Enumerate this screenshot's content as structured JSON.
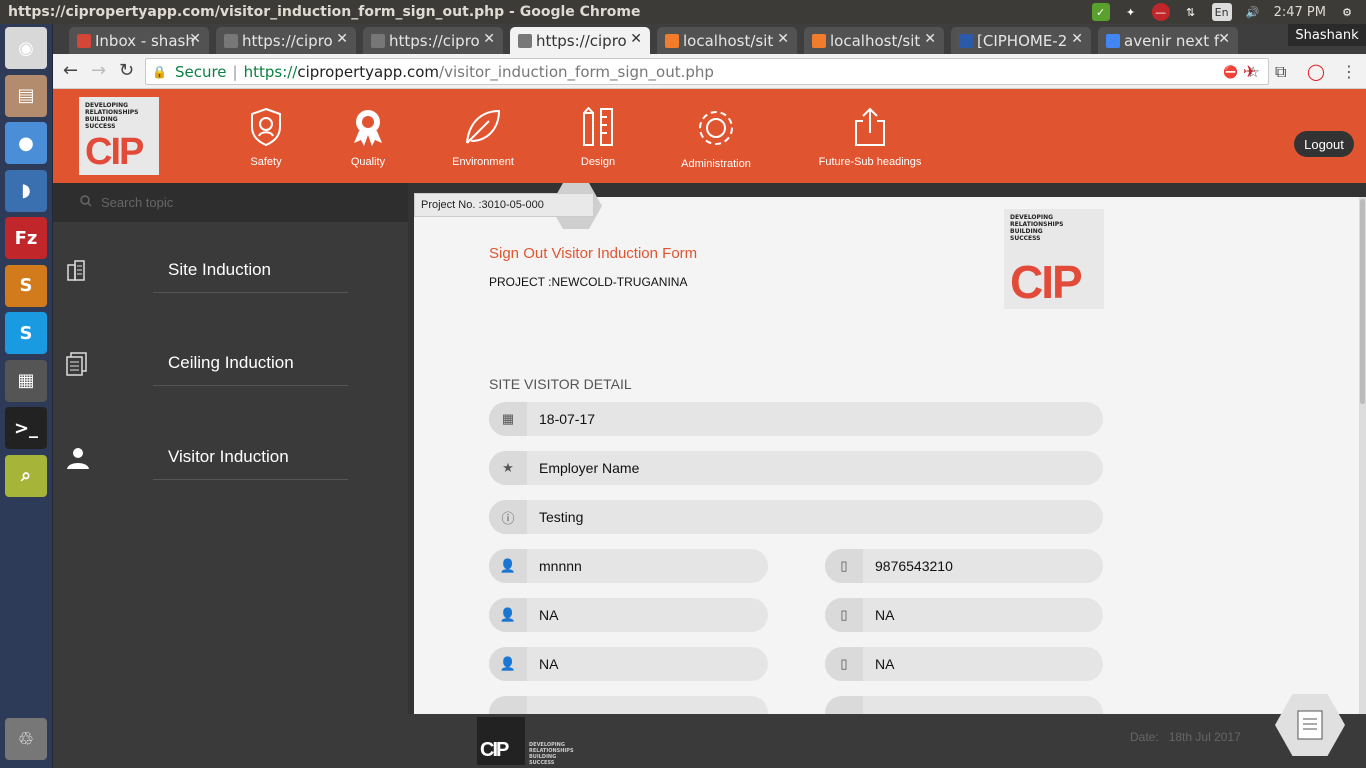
{
  "os": {
    "window_title": "https://cipropertyapp.com/visitor_induction_form_sign_out.php - Google Chrome",
    "lang": "En",
    "time": "2:47 PM",
    "launcher": [
      {
        "icon": "ubuntu-icon",
        "color": "#d8d8d8",
        "glyph": "◉"
      },
      {
        "icon": "files-icon",
        "color": "#b38b6d",
        "glyph": "▤"
      },
      {
        "icon": "chrome-icon",
        "color": "#4a8ed8",
        "glyph": "●"
      },
      {
        "icon": "dolphin-icon",
        "color": "#3a6fb0",
        "glyph": "◗"
      },
      {
        "icon": "filezilla-icon",
        "color": "#c0262a",
        "glyph": "Fz"
      },
      {
        "icon": "sublime-icon",
        "color": "#d17b1d",
        "glyph": "S"
      },
      {
        "icon": "skype-icon",
        "color": "#1a9ae0",
        "glyph": "S"
      },
      {
        "icon": "video-editor-icon",
        "color": "#555",
        "glyph": "▦"
      },
      {
        "icon": "terminal-icon",
        "color": "#222",
        "glyph": ">_"
      },
      {
        "icon": "screenshot-icon",
        "color": "#a6b43a",
        "glyph": "⌕"
      },
      {
        "icon": "trash-icon",
        "color": "#777",
        "glyph": "♲"
      }
    ]
  },
  "browser": {
    "profile": "Shashank",
    "tabs": [
      {
        "title": "Inbox - shash",
        "fav": "#d44638",
        "active": false
      },
      {
        "title": "https://cipro",
        "fav": "#777",
        "active": false
      },
      {
        "title": "https://cipro",
        "fav": "#777",
        "active": false
      },
      {
        "title": "https://cipro",
        "fav": "#777",
        "active": true
      },
      {
        "title": "localhost/sit",
        "fav": "#f07c2c",
        "active": false
      },
      {
        "title": "localhost/sit",
        "fav": "#f07c2c",
        "active": false
      },
      {
        "title": "[CIPHOME-2",
        "fav": "#2a5aa8",
        "active": false
      },
      {
        "title": "avenir next f",
        "fav": "#4285f4",
        "active": false
      }
    ],
    "secure_label": "Secure",
    "url_scheme": "https://",
    "url_host": "cipropertyapp.com",
    "url_path": "/visitor_induction_form_sign_out.php"
  },
  "app": {
    "logo_tagline": "DEVELOPING RELATIONSHIPS BUILDING SUCCESS",
    "logo_text": "CIP",
    "nav": [
      {
        "label": "Safety",
        "icon": "shield-icon"
      },
      {
        "label": "Quality",
        "icon": "award-icon"
      },
      {
        "label": "Environment",
        "icon": "leaf-icon"
      },
      {
        "label": "Design",
        "icon": "pencil-ruler-icon"
      },
      {
        "label": "Administration",
        "icon": "gear-icon"
      },
      {
        "label": "Future-Sub headings",
        "icon": "share-icon"
      }
    ],
    "logout": "Logout",
    "search_placeholder": "Search topic",
    "sidebar": [
      {
        "label": "Site Induction",
        "icon": "building-icon"
      },
      {
        "label": "Ceiling Induction",
        "icon": "documents-icon"
      },
      {
        "label": "Visitor Induction",
        "icon": "visitor-icon"
      }
    ],
    "project_no": "Project No. :3010-05-000",
    "form": {
      "title": "Sign Out Visitor Induction Form",
      "project": "PROJECT :NEWCOLD-TRUGANINA",
      "section": "SITE VISITOR DETAIL",
      "date": "18-07-17",
      "employer": "Employer Name",
      "info": "Testing",
      "visitors": [
        {
          "name": "mnnnn",
          "phone": "9876543210"
        },
        {
          "name": "NA",
          "phone": "NA"
        },
        {
          "name": "NA",
          "phone": "NA"
        }
      ]
    },
    "footer_date_label": "Date:",
    "footer_date": "18th Jul 2017"
  }
}
